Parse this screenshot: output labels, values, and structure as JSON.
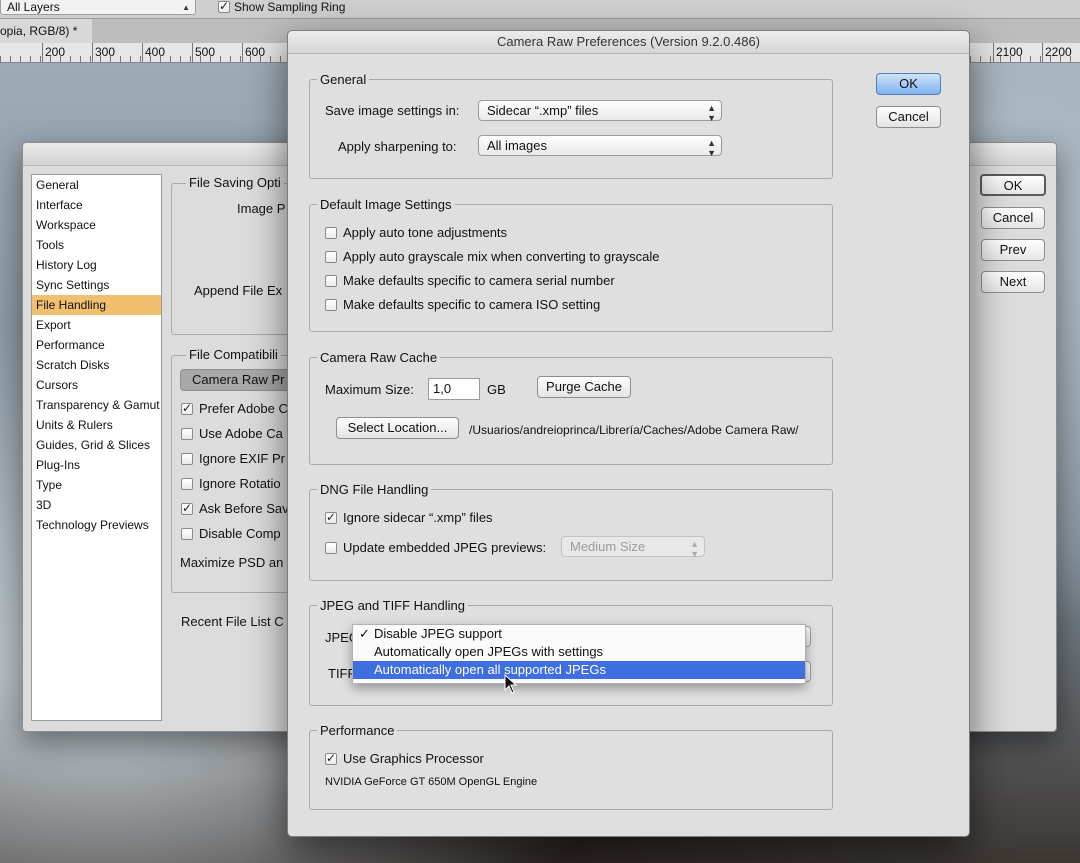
{
  "ps_options_bar": {
    "sample_select": "All Layers",
    "show_sampling_ring_label": "Show Sampling Ring",
    "show_sampling_ring_checked": true
  },
  "doc_tab": {
    "label": "opia, RGB/8) *"
  },
  "ruler": {
    "ticks_left": [
      "200",
      "300",
      "400",
      "500",
      "600"
    ],
    "ticks_right": [
      "2100",
      "2200"
    ]
  },
  "preferences_dialog": {
    "sidebar": {
      "items": [
        "General",
        "Interface",
        "Workspace",
        "Tools",
        "History Log",
        "Sync Settings",
        "File Handling",
        "Export",
        "Performance",
        "Scratch Disks",
        "Cursors",
        "Transparency & Gamut",
        "Units & Rulers",
        "Guides, Grid & Slices",
        "Plug-Ins",
        "Type",
        "3D",
        "Technology Previews"
      ],
      "selected": "File Handling"
    },
    "file_saving_group": "File Saving Opti",
    "image_previews_label": "Image P",
    "append_file_ext_label": "Append File Ex",
    "file_compat_group": "File Compatibili",
    "camera_raw_button": "Camera Raw Pr",
    "checks": [
      {
        "label": "Prefer Adobe C",
        "checked": true
      },
      {
        "label": "Use Adobe Ca",
        "checked": false
      },
      {
        "label": "Ignore EXIF Pr",
        "checked": false
      },
      {
        "label": "Ignore Rotatio",
        "checked": false
      },
      {
        "label": "Ask Before Sav",
        "checked": true
      },
      {
        "label": "Disable Comp",
        "checked": false
      }
    ],
    "maximize_label": "Maximize PSD an",
    "recent_files_label": "Recent File List C",
    "buttons": {
      "ok": "OK",
      "cancel": "Cancel",
      "prev": "Prev",
      "next": "Next"
    }
  },
  "camera_raw_dialog": {
    "title": "Camera Raw Preferences  (Version 9.2.0.486)",
    "ok": "OK",
    "cancel": "Cancel",
    "general": {
      "title": "General",
      "save_label": "Save image settings in:",
      "save_value": "Sidecar “.xmp” files",
      "sharpen_label": "Apply sharpening to:",
      "sharpen_value": "All images"
    },
    "default_image_settings": {
      "title": "Default Image Settings",
      "options": [
        {
          "label": "Apply auto tone adjustments",
          "checked": false
        },
        {
          "label": "Apply auto grayscale mix when converting to grayscale",
          "checked": false
        },
        {
          "label": "Make defaults specific to camera serial number",
          "checked": false
        },
        {
          "label": "Make defaults specific to camera ISO setting",
          "checked": false
        }
      ]
    },
    "cache": {
      "title": "Camera Raw Cache",
      "max_size_label": "Maximum Size:",
      "max_size_value": "1,0",
      "unit": "GB",
      "purge": "Purge Cache",
      "select_location": "Select Location...",
      "path": "/Usuarios/andreioprinca/Librería/Caches/Adobe Camera Raw/"
    },
    "dng": {
      "title": "DNG File Handling",
      "ignore_sidecar_label": "Ignore sidecar “.xmp” files",
      "ignore_sidecar_checked": true,
      "update_jpeg_label": "Update embedded JPEG previews:",
      "update_jpeg_checked": false,
      "preview_size": "Medium Size"
    },
    "jpeg_tiff": {
      "title": "JPEG and TIFF Handling",
      "jpeg_label": "JPEG",
      "tiff_label": "TIFF",
      "menu_items": [
        "Disable JPEG support",
        "Automatically open JPEGs with settings",
        "Automatically open all supported JPEGs"
      ],
      "checked_index": 0,
      "highlighted_index": 2
    },
    "performance": {
      "title": "Performance",
      "gpu_label": "Use Graphics Processor",
      "gpu_checked": true,
      "gpu_name": "NVIDIA GeForce GT 650M OpenGL Engine"
    }
  }
}
